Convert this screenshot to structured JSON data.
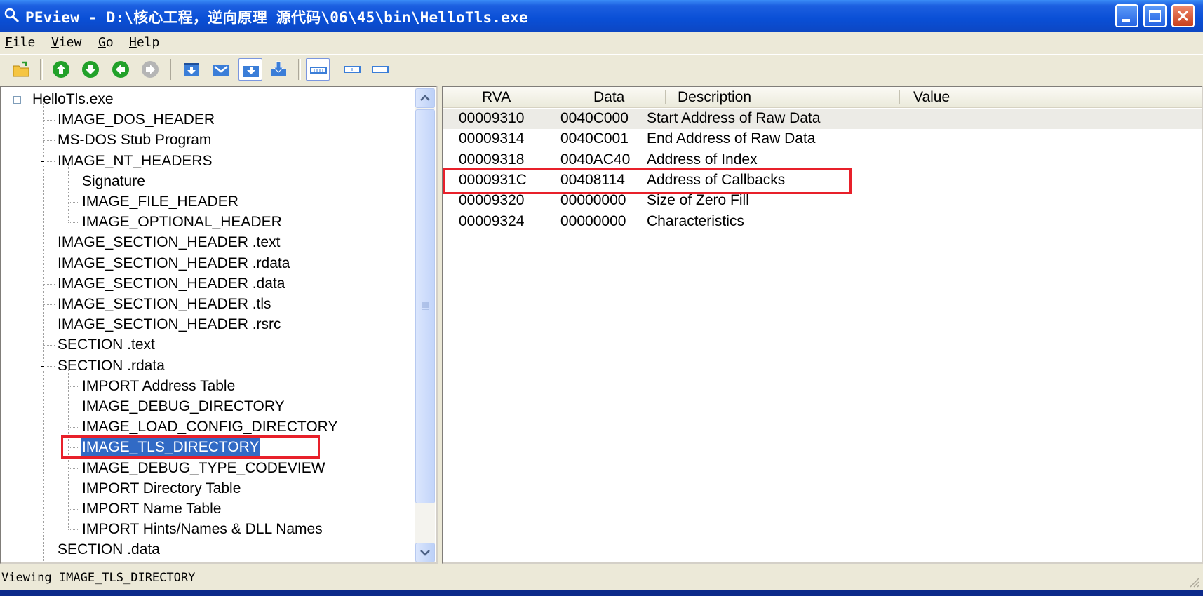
{
  "window": {
    "title": "PEview - D:\\核心工程，逆向原理 源代码\\06\\45\\bin\\HelloTls.exe"
  },
  "menu": [
    {
      "key": "F",
      "rest": "ile"
    },
    {
      "key": "V",
      "rest": "iew"
    },
    {
      "key": "G",
      "rest": "o"
    },
    {
      "key": "H",
      "rest": "elp"
    }
  ],
  "toolbar": {
    "icons": [
      "open-folder-icon",
      "back-icon",
      "forward-icon",
      "up-icon",
      "down-icon",
      "expand-icon",
      "collapse-icon",
      "view-byte-icon",
      "view-word-icon",
      "view-dword-icon",
      "view-qword-icon",
      "hex-icon"
    ]
  },
  "tree": {
    "items": [
      {
        "label": "HelloTls.exe",
        "level": 0
      },
      {
        "label": "IMAGE_DOS_HEADER",
        "level": 1
      },
      {
        "label": "MS-DOS Stub Program",
        "level": 1
      },
      {
        "label": "IMAGE_NT_HEADERS",
        "level": 1
      },
      {
        "label": "Signature",
        "level": 2
      },
      {
        "label": "IMAGE_FILE_HEADER",
        "level": 2
      },
      {
        "label": "IMAGE_OPTIONAL_HEADER",
        "level": 2
      },
      {
        "label": "IMAGE_SECTION_HEADER .text",
        "level": 1
      },
      {
        "label": "IMAGE_SECTION_HEADER .rdata",
        "level": 1
      },
      {
        "label": "IMAGE_SECTION_HEADER .data",
        "level": 1
      },
      {
        "label": "IMAGE_SECTION_HEADER .tls",
        "level": 1
      },
      {
        "label": "IMAGE_SECTION_HEADER .rsrc",
        "level": 1
      },
      {
        "label": "SECTION .text",
        "level": 1
      },
      {
        "label": "SECTION .rdata",
        "level": 1
      },
      {
        "label": "IMPORT Address Table",
        "level": 2
      },
      {
        "label": "IMAGE_DEBUG_DIRECTORY",
        "level": 2
      },
      {
        "label": "IMAGE_LOAD_CONFIG_DIRECTORY",
        "level": 2
      },
      {
        "label": "IMAGE_TLS_DIRECTORY",
        "level": 2,
        "selected": true
      },
      {
        "label": "IMAGE_DEBUG_TYPE_CODEVIEW",
        "level": 2
      },
      {
        "label": "IMPORT Directory Table",
        "level": 2
      },
      {
        "label": "IMPORT Name Table",
        "level": 2
      },
      {
        "label": "IMPORT Hints/Names & DLL Names",
        "level": 2
      },
      {
        "label": "SECTION .data",
        "level": 1
      }
    ]
  },
  "list": {
    "columns": [
      "RVA",
      "Data",
      "Description",
      "Value"
    ],
    "rows": [
      [
        "00009310",
        "0040C000",
        "Start Address of Raw Data",
        ""
      ],
      [
        "00009314",
        "0040C001",
        "End Address of Raw Data",
        ""
      ],
      [
        "00009318",
        "0040AC40",
        "Address of Index",
        ""
      ],
      [
        "0000931C",
        "00408114",
        "Address of Callbacks",
        ""
      ],
      [
        "00009320",
        "00000000",
        "Size of Zero Fill",
        ""
      ],
      [
        "00009324",
        "00000000",
        "Characteristics",
        ""
      ]
    ]
  },
  "status": {
    "text": "Viewing IMAGE_TLS_DIRECTORY"
  },
  "colors": {
    "title_bar": "#0a4fd6",
    "selection": "#316ac5",
    "annotation": "#e8202a"
  }
}
